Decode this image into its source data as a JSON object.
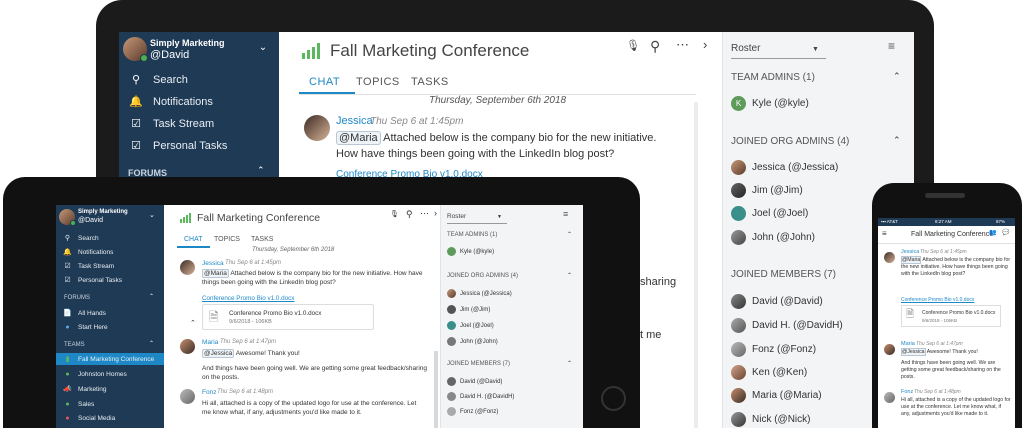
{
  "app": {
    "title": "Fall Marketing Conference"
  },
  "user": {
    "org": "Simply Marketing",
    "handle": "@David"
  },
  "nav": {
    "search": "Search",
    "notifications": "Notifications",
    "task_stream": "Task Stream",
    "personal_tasks": "Personal Tasks"
  },
  "forums": {
    "header": "FORUMS",
    "items": [
      "All Hands",
      "Start Here"
    ]
  },
  "teams": {
    "header": "TEAMS",
    "items": [
      "Fall Marketing Conference",
      "Johnston Homes",
      "Marketing",
      "Sales",
      "Social Media"
    ]
  },
  "tabs": {
    "chat": "CHAT",
    "topics": "TOPICS",
    "tasks": "TASKS"
  },
  "chat": {
    "date": "Thursday, September 6th 2018",
    "msg1": {
      "author": "Jessica",
      "time": "Thu Sep 6 at 1:45pm",
      "mention": "@Maria",
      "text": "Attached below is the company bio for the new initiative. How have things been going with the LinkedIn blog post?",
      "link": "Conference Promo Bio v1.0.docx",
      "file_name": "Conference Promo Bio v1.0.docx",
      "file_meta": "9/6/2018 - 106KB"
    },
    "msg2": {
      "author": "Maria",
      "time": "Thu Sep 6 at 1:47pm",
      "mention": "@Jessica",
      "text": "Awesome! Thank you!",
      "text2": "And things have been going well. We are getting some great feedback/sharing on the posts."
    },
    "msg3": {
      "author": "Fonz",
      "time": "Thu Sep 6 at 1:48pm",
      "text": "Hi all, attached is a copy of the updated logo for use at the conference. Let me know what, if any, adjustments you'd like made to it."
    },
    "partial1": "sharing",
    "partial2": "t me"
  },
  "roster": {
    "label": "Roster",
    "team_admins": "TEAM ADMINS (1)",
    "team_admin_items": [
      "Kyle (@kyle)"
    ],
    "org_admins": "JOINED ORG ADMINS (4)",
    "org_admin_items": [
      "Jessica (@Jessica)",
      "Jim (@Jim)",
      "Joel (@Joel)",
      "John (@John)"
    ],
    "members": "JOINED MEMBERS (7)",
    "member_items": [
      "David (@David)",
      "David H. (@DavidH)",
      "Fonz (@Fonz)",
      "Ken (@Ken)",
      "Maria (@Maria)",
      "Nick (@Nick)"
    ]
  },
  "phone": {
    "carrier": "▪▪▪ AT&T",
    "clock": "8:27 AM",
    "battery": "87%"
  },
  "colors": {
    "sidebar": "#1f3a55",
    "accent": "#1e88c7",
    "online": "#4caf50",
    "chart_icon": "#5cb85c"
  }
}
